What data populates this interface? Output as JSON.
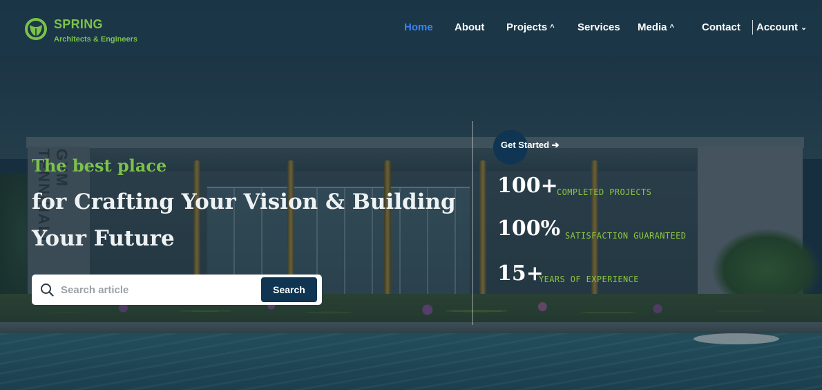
{
  "brand": {
    "name": "SPRING",
    "tagline": "Architects & Engineers",
    "accent_color": "#7cc24a"
  },
  "nav": {
    "items": [
      {
        "label": "Home",
        "active": true,
        "has_dropdown": false
      },
      {
        "label": "About",
        "active": false,
        "has_dropdown": false
      },
      {
        "label": "Projects",
        "active": false,
        "has_dropdown": true,
        "caret_icon": "chevron-up-icon"
      },
      {
        "label": "Services",
        "active": false,
        "has_dropdown": false
      },
      {
        "label": "Media",
        "active": false,
        "has_dropdown": true,
        "caret_icon": "chevron-up-icon"
      },
      {
        "label": "Contact",
        "active": false,
        "has_dropdown": false
      }
    ],
    "account": {
      "label": "Account",
      "caret_icon": "chevron-down-icon"
    },
    "active_color": "#3b82f6"
  },
  "hero": {
    "tagline": "The best place",
    "headline_line1": "for Crafting Your Vision & Building",
    "headline_line2": "Your Future",
    "building_sign": "GYM TENNIHALL"
  },
  "search": {
    "placeholder": "Search article",
    "value": "",
    "button_label": "Search",
    "icon": "search-icon"
  },
  "cta": {
    "label": "Get Started ➔",
    "color": "#0f3552"
  },
  "stats": [
    {
      "value": "100+",
      "label": "COMPLETED PROJECTS"
    },
    {
      "value": "100%",
      "label": "SATISFACTION GUARANTEED"
    },
    {
      "value": "15+",
      "label": "YEARS OF EXPERIENCE"
    }
  ]
}
